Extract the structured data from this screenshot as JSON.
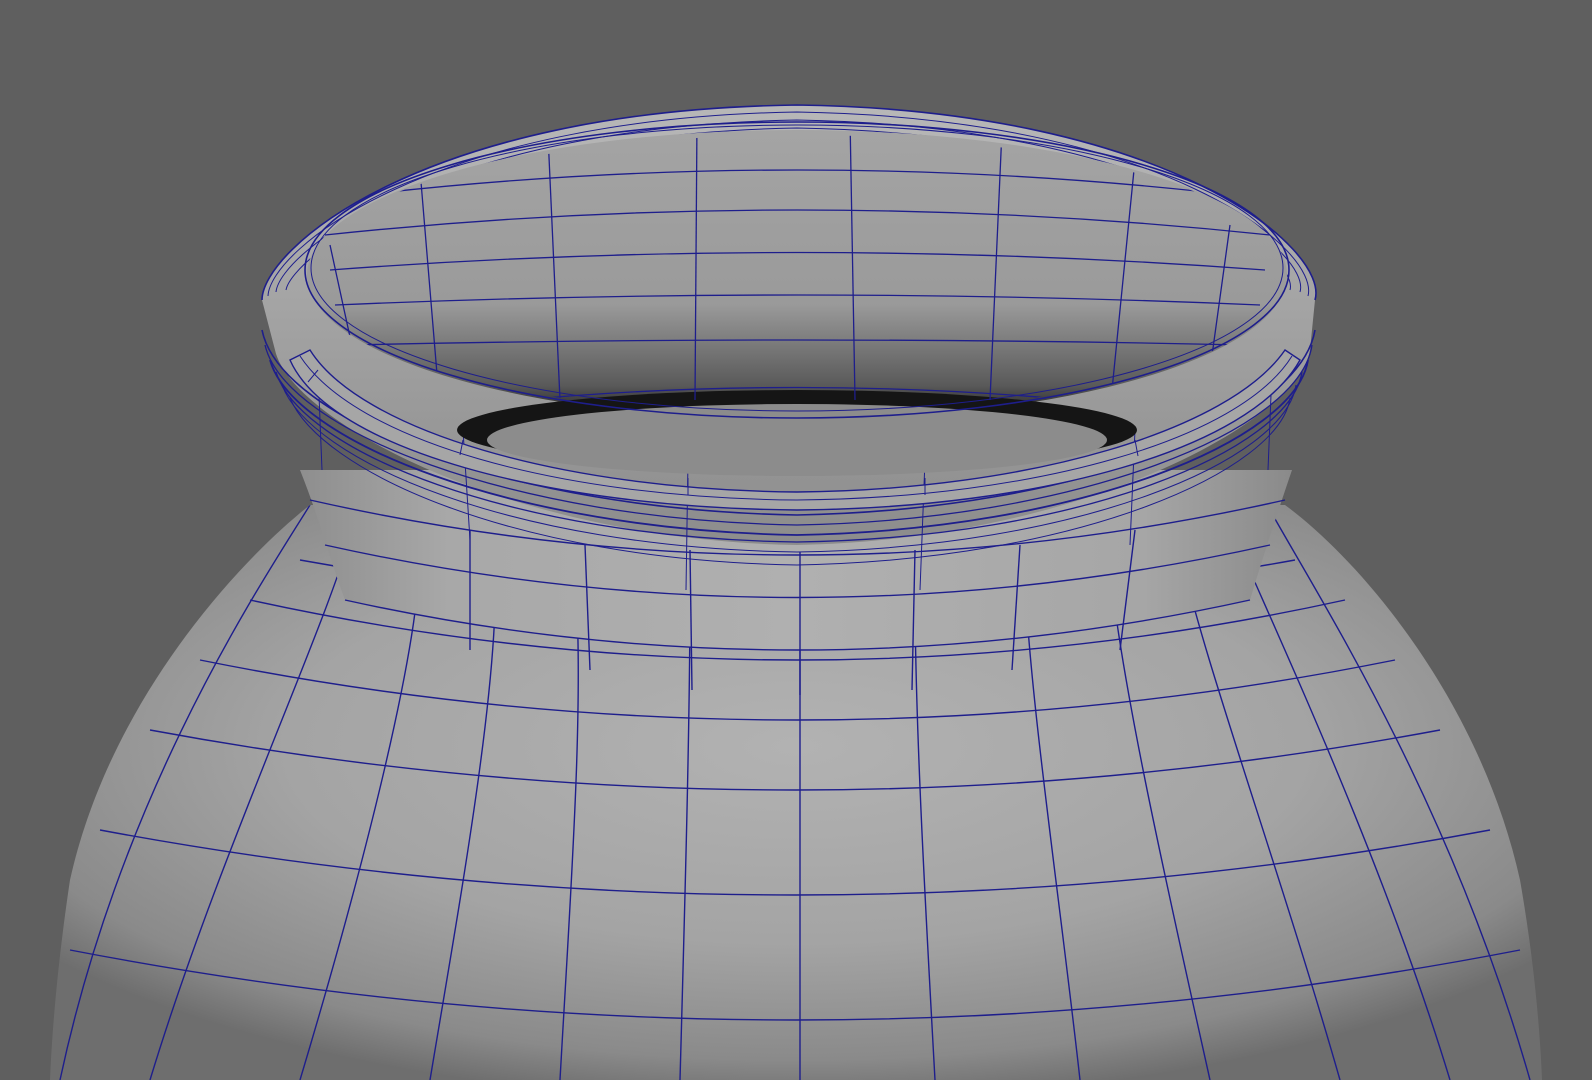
{
  "viewport": {
    "background_color": "#5f5f5f",
    "shading": "smooth-shaded-with-wireframe",
    "wireframe_color": "#1e1e8c",
    "surface_color_light": "#a9a9a9",
    "surface_color_dark": "#7a7a7a",
    "object": "vase-mesh",
    "view": "perspective-close-up-of-vase-neck-and-rim"
  }
}
